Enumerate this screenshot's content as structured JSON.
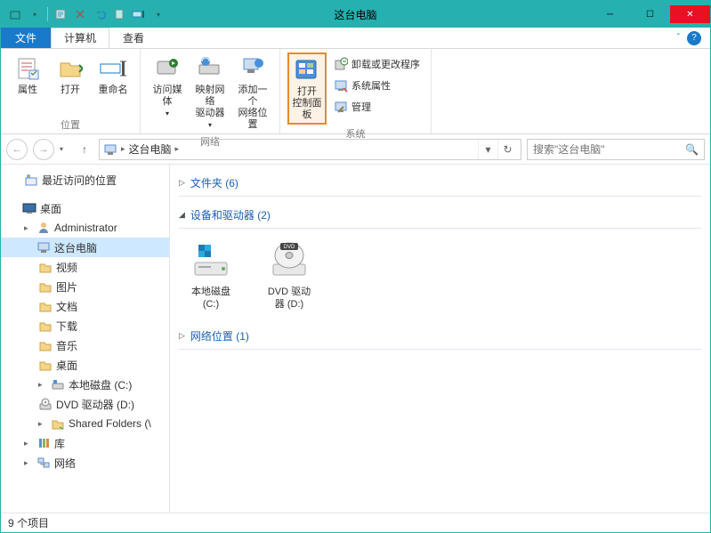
{
  "window": {
    "title": "这台电脑"
  },
  "tabs": {
    "file": "文件",
    "computer": "计算机",
    "view": "查看"
  },
  "ribbon": {
    "group_location": "位置",
    "group_network": "网络",
    "group_system": "系统",
    "properties": "属性",
    "open": "打开",
    "rename": "重命名",
    "media": "访问媒体",
    "map_drive": "映射网络\n驱动器",
    "add_location": "添加一个\n网络位置",
    "control_panel": "打开\n控制面板",
    "uninstall": "卸载或更改程序",
    "sys_props": "系统属性",
    "manage": "管理"
  },
  "nav": {
    "breadcrumb": "这台电脑",
    "search_placeholder": "搜索\"这台电脑\""
  },
  "tree": {
    "recent": "最近访问的位置",
    "desktop": "桌面",
    "admin": "Administrator",
    "thispc": "这台电脑",
    "videos": "视频",
    "pictures": "图片",
    "documents": "文档",
    "downloads": "下载",
    "music": "音乐",
    "desktop2": "桌面",
    "cdrive": "本地磁盘 (C:)",
    "dvd": "DVD 驱动器 (D:)",
    "shared": "Shared Folders (\\",
    "libraries": "库",
    "network": "网络"
  },
  "content": {
    "folders_hdr": "文件夹 (6)",
    "devices_hdr": "设备和驱动器 (2)",
    "netloc_hdr": "网络位置 (1)",
    "drive_c": "本地磁盘\n(C:)",
    "drive_d": "DVD 驱动\n器 (D:)"
  },
  "status": {
    "count": "9 个项目"
  }
}
